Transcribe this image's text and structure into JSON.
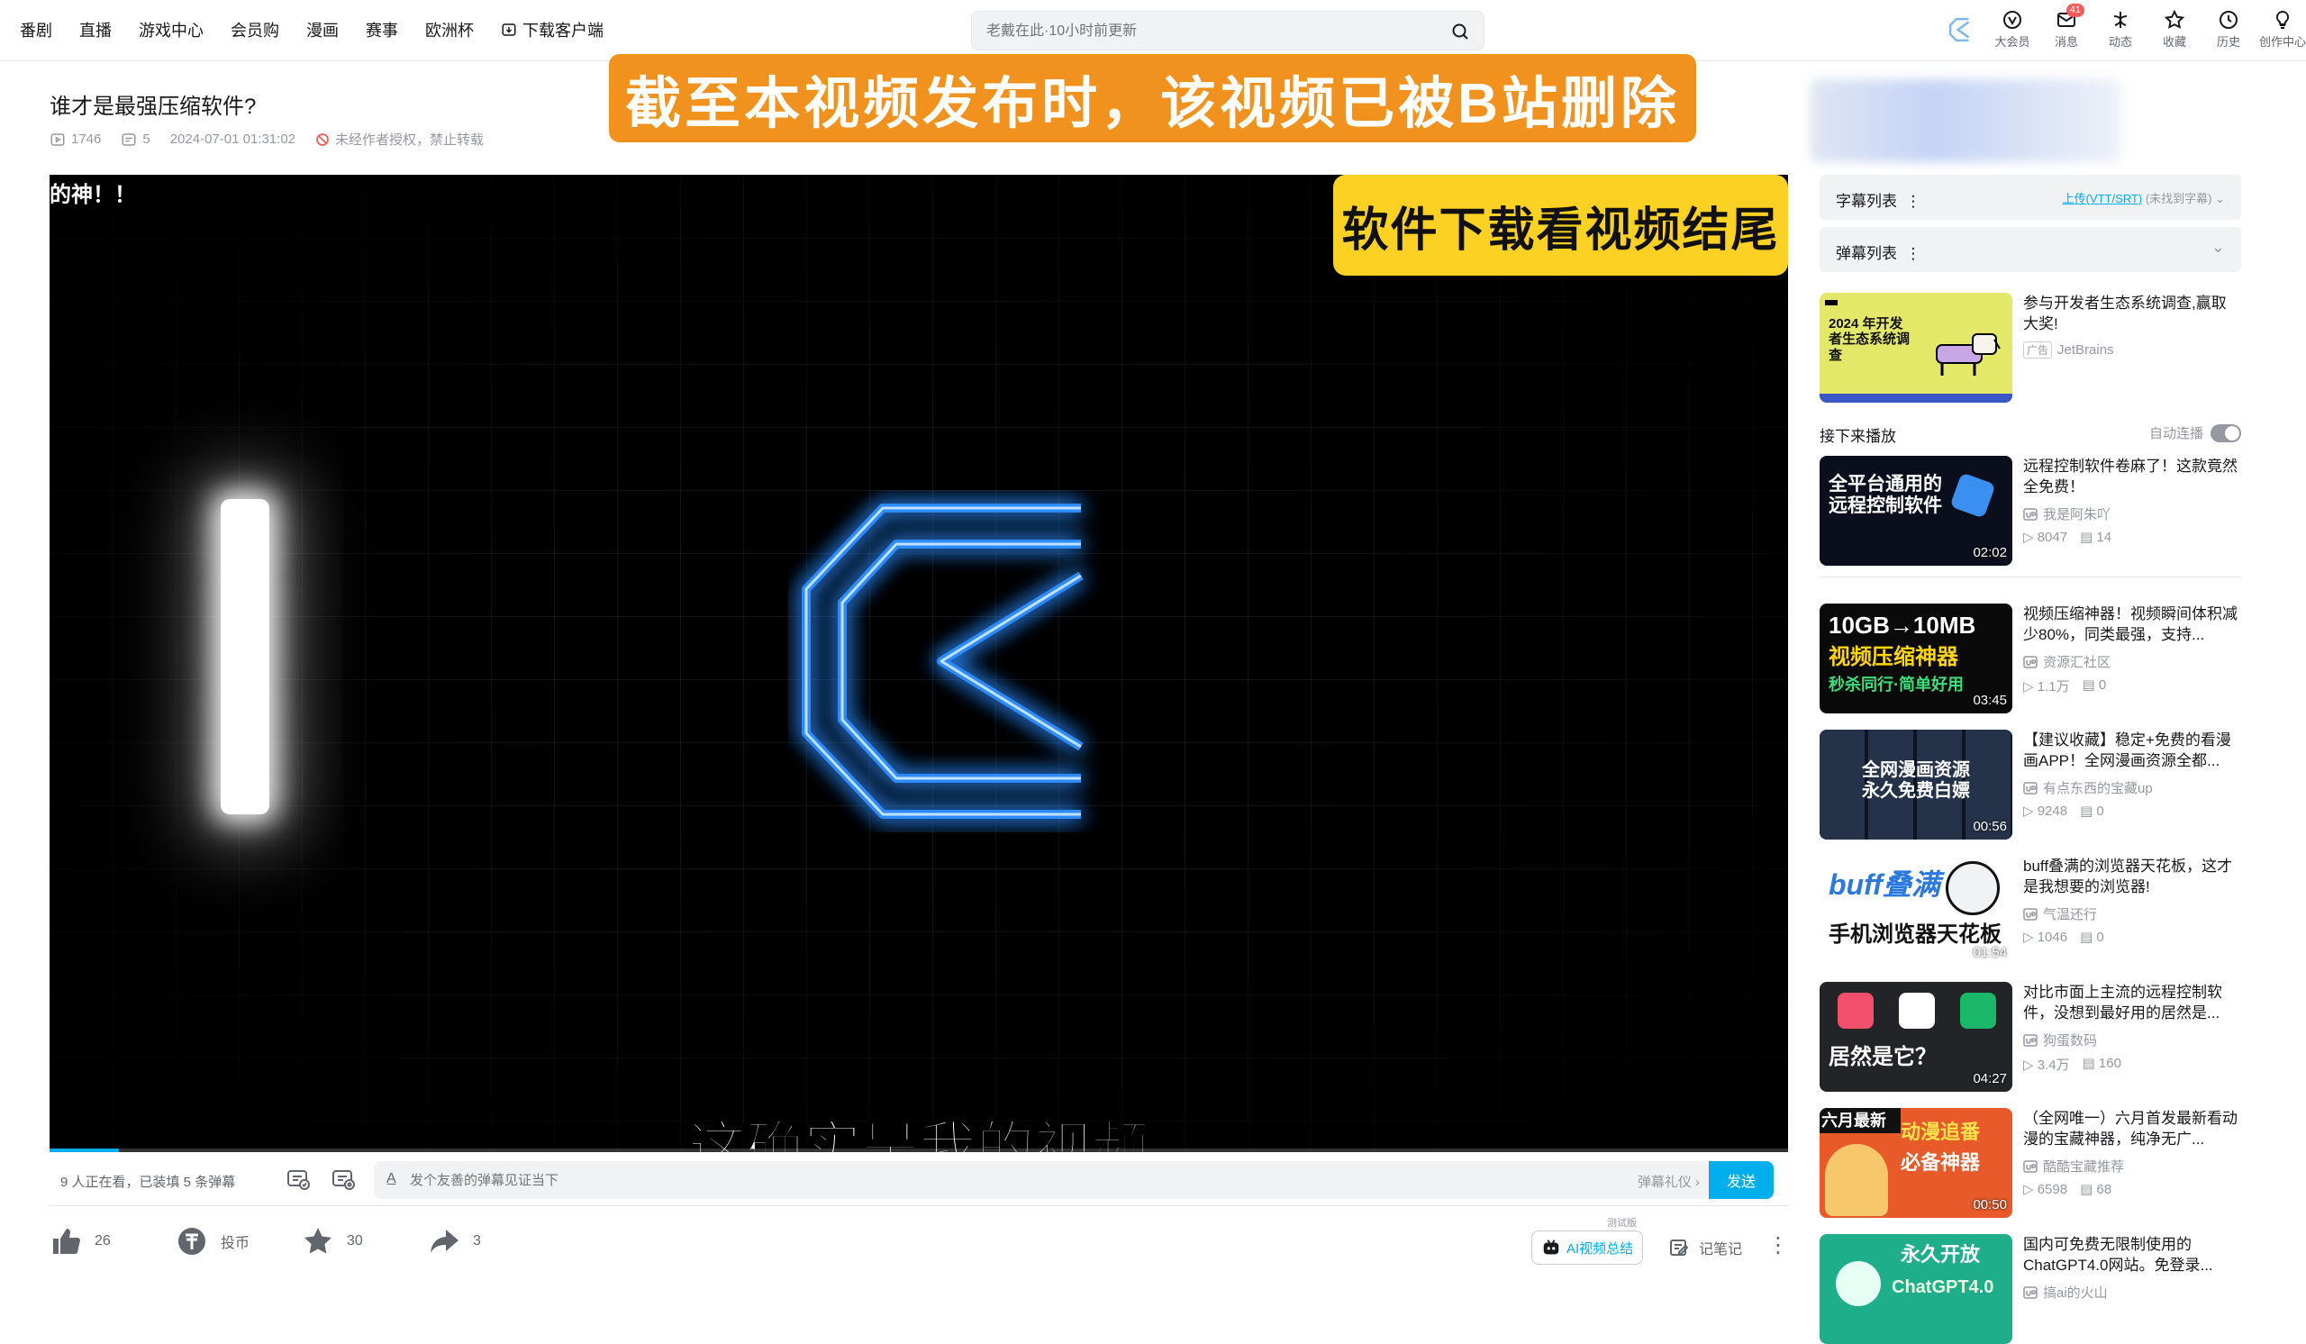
{
  "nav": {
    "left": [
      "番剧",
      "直播",
      "游戏中心",
      "会员购",
      "漫画",
      "赛事",
      "欧洲杯"
    ],
    "download_client": "下载客户端",
    "search_placeholder": "老戴在此·10小时前更新",
    "right": [
      {
        "label": "大会员",
        "icon": "vip-icon"
      },
      {
        "label": "消息",
        "icon": "message-icon",
        "badge": "41"
      },
      {
        "label": "动态",
        "icon": "dynamic-icon"
      },
      {
        "label": "收藏",
        "icon": "star-icon"
      },
      {
        "label": "历史",
        "icon": "clock-icon"
      },
      {
        "label": "创作中心",
        "icon": "bulb-icon"
      }
    ]
  },
  "video": {
    "title": "谁才是最强压缩软件?",
    "views": "1746",
    "danmaku_count": "5",
    "date": "2024-07-01 01:31:02",
    "rights": "未经作者授权，禁止转载",
    "banner": "截至本视频发布时，该视频已被B站删除",
    "frame_top_text": "的神！！",
    "frame_badge": "软件下载看视频结尾",
    "subtitle": "这确实是我的视频",
    "progress": 0.04
  },
  "danmaku_bar": {
    "status": "9 人正在看，已装填 5 条弹幕",
    "input_placeholder": "发个友善的弹幕见证当下",
    "etiquette": "弹幕礼仪 ›",
    "send": "发送"
  },
  "actions": {
    "like": "26",
    "coin": "投币",
    "favorite": "30",
    "share": "3",
    "ai_summary": "AI视频总结",
    "ai_beta": "测试版",
    "notes": "记笔记"
  },
  "sidebar": {
    "subtitle_list": "字幕列表",
    "upload_link": "上传(VTT/SRT)",
    "no_subtitle": "(未找到字幕)",
    "danmaku_list": "弹幕列表",
    "ad": {
      "title": "参与开发者生态系统调查,赢取大奖!",
      "tag": "广告",
      "advertiser": "JetBrains",
      "thumb_text": "2024 年开发者生态系统调查"
    },
    "up_next": "接下来播放",
    "autoplay": "自动连播",
    "autoplay_on": false,
    "videos": [
      {
        "title": "远程控制软件卷麻了！这款竟然全免费！",
        "up": "我是阿朱吖",
        "views": "8047",
        "dm": "14",
        "duration": "02:02",
        "thumb": "全平台通用的 远程控制软件",
        "bg": "#0b0e1c"
      },
      {
        "title": "视频压缩神器！视频瞬间体积减少80%，同类最强，支持...",
        "up": "资源汇社区",
        "views": "1.1万",
        "dm": "0",
        "duration": "03:45",
        "thumb": "10GB→10MB 视频压缩神器",
        "bg": "#0a0a0a"
      },
      {
        "title": "【建议收藏】稳定+免费的看漫画APP！全网漫画资源全都...",
        "up": "有点东西的宝藏up",
        "views": "9248",
        "dm": "0",
        "duration": "00:56",
        "thumb": "全网漫画资源 永久免费白嫖",
        "bg": "#1d2a3d"
      },
      {
        "title": "buff叠满的浏览器天花板，这才是我想要的浏览器!",
        "up": "气温还行",
        "views": "1046",
        "dm": "0",
        "duration": "01:54",
        "thumb": "buff叠满 手机浏览器天花板",
        "bg": "#ffffff"
      },
      {
        "title": "对比市面上主流的远程控制软件，没想到最好用的居然是...",
        "up": "狗蛋数码",
        "views": "3.4万",
        "dm": "160",
        "duration": "04:27",
        "thumb": "居然是它？",
        "bg": "#222428"
      },
      {
        "title": "（全网唯一）六月首发最新看动漫的宝藏神器，纯净无广...",
        "up": "酷酷宝藏推荐",
        "views": "6598",
        "dm": "68",
        "duration": "00:50",
        "thumb": "六月最新 动漫追番 必备神器",
        "bg": "#e85a2a"
      },
      {
        "title": "国内可免费无限制使用的ChatGPT4.0网站。免登录...",
        "up": "搞ai的火山",
        "views": "",
        "dm": "",
        "duration": "",
        "thumb": "永久开放 ChatGPT4.0",
        "bg": "#1fae8a"
      }
    ]
  }
}
